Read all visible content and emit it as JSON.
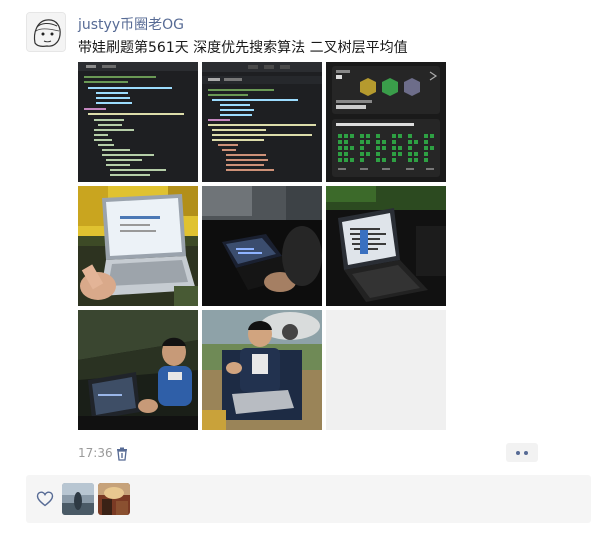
{
  "post": {
    "author": "justyy币圈老OG",
    "text": "带娃刷题第561天 深度优先搜索算法 二叉树层平均值",
    "time": "17:36"
  },
  "photos": [
    {
      "name": "code-screenshot-python"
    },
    {
      "name": "code-screenshot-rust"
    },
    {
      "name": "badge-and-submissions-screenshot"
    },
    {
      "name": "laptop-on-lap-photo"
    },
    {
      "name": "laptop-in-tent-dark-photo"
    },
    {
      "name": "laptop-screen-dark-photo"
    },
    {
      "name": "boy-in-tent-photo"
    },
    {
      "name": "boy-in-chair-photo"
    },
    {
      "name": "empty-slot"
    }
  ],
  "likers": [
    {
      "name": "liker-avatar-1"
    },
    {
      "name": "liker-avatar-2"
    }
  ],
  "icons": {
    "delete": "trash-icon",
    "more": "more-dots-icon",
    "like": "heart-outline-icon"
  },
  "colors": {
    "author": "#576b95",
    "text": "#191919",
    "time": "#9a9a9a",
    "likes_bg": "#f5f5f5"
  }
}
